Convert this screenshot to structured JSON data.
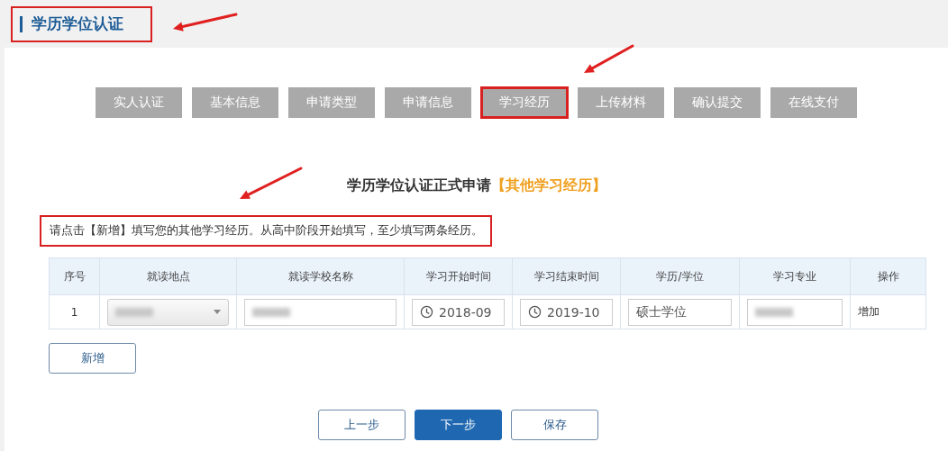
{
  "header": {
    "title": "学历学位认证",
    "highlighted": true
  },
  "steps": [
    {
      "label": "实人认证",
      "highlighted": false
    },
    {
      "label": "基本信息",
      "highlighted": false
    },
    {
      "label": "申请类型",
      "highlighted": false
    },
    {
      "label": "申请信息",
      "highlighted": false
    },
    {
      "label": "学习经历",
      "highlighted": true
    },
    {
      "label": "上传材料",
      "highlighted": false
    },
    {
      "label": "确认提交",
      "highlighted": false
    },
    {
      "label": "在线支付",
      "highlighted": false
    }
  ],
  "heading": {
    "text": "学历学位认证正式申请",
    "accent": "【其他学习经历】"
  },
  "notice": {
    "text": "请点击【新增】填写您的其他学习经历。从高中阶段开始填写，至少填写两条经历。",
    "highlighted": true
  },
  "table": {
    "columns": [
      "序号",
      "就读地点",
      "就读学校名称",
      "学习开始时间",
      "学习结束时间",
      "学历/学位",
      "学习专业",
      "操作"
    ],
    "rows": [
      {
        "cells": [
          {
            "kind": "text",
            "value": "1"
          },
          {
            "kind": "select",
            "redacted": true
          },
          {
            "kind": "input",
            "redacted": true
          },
          {
            "kind": "date",
            "value": "2018-09"
          },
          {
            "kind": "date",
            "value": "2019-10"
          },
          {
            "kind": "input",
            "value": "硕士学位",
            "redacted": false
          },
          {
            "kind": "input",
            "redacted": true
          },
          {
            "kind": "link",
            "value": "增加"
          }
        ]
      }
    ]
  },
  "add_button": "新增",
  "nav_buttons": [
    {
      "label": "上一步",
      "primary": false
    },
    {
      "label": "下一步",
      "primary": true
    },
    {
      "label": "保存",
      "primary": false
    }
  ]
}
